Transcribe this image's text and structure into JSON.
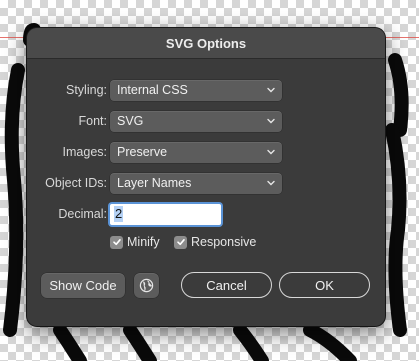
{
  "dialog": {
    "title": "SVG Options"
  },
  "fields": {
    "styling": {
      "label": "Styling:",
      "value": "Internal CSS"
    },
    "font": {
      "label": "Font:",
      "value": "SVG"
    },
    "images": {
      "label": "Images:",
      "value": "Preserve"
    },
    "object_ids": {
      "label": "Object IDs:",
      "value": "Layer Names"
    },
    "decimal": {
      "label": "Decimal:",
      "value": "2"
    }
  },
  "options": {
    "minify": {
      "label": "Minify",
      "checked": true
    },
    "responsive": {
      "label": "Responsive",
      "checked": true
    }
  },
  "buttons": {
    "show_code": "Show Code",
    "cancel": "Cancel",
    "ok": "OK"
  },
  "icons": {
    "web": "globe-icon",
    "dropdown": "chevron-updown-icon",
    "check": "checkmark-icon"
  },
  "colors": {
    "dialog_bg": "#3b3b3b",
    "focus_ring": "#5a93d6",
    "guide": "#e0504a"
  }
}
